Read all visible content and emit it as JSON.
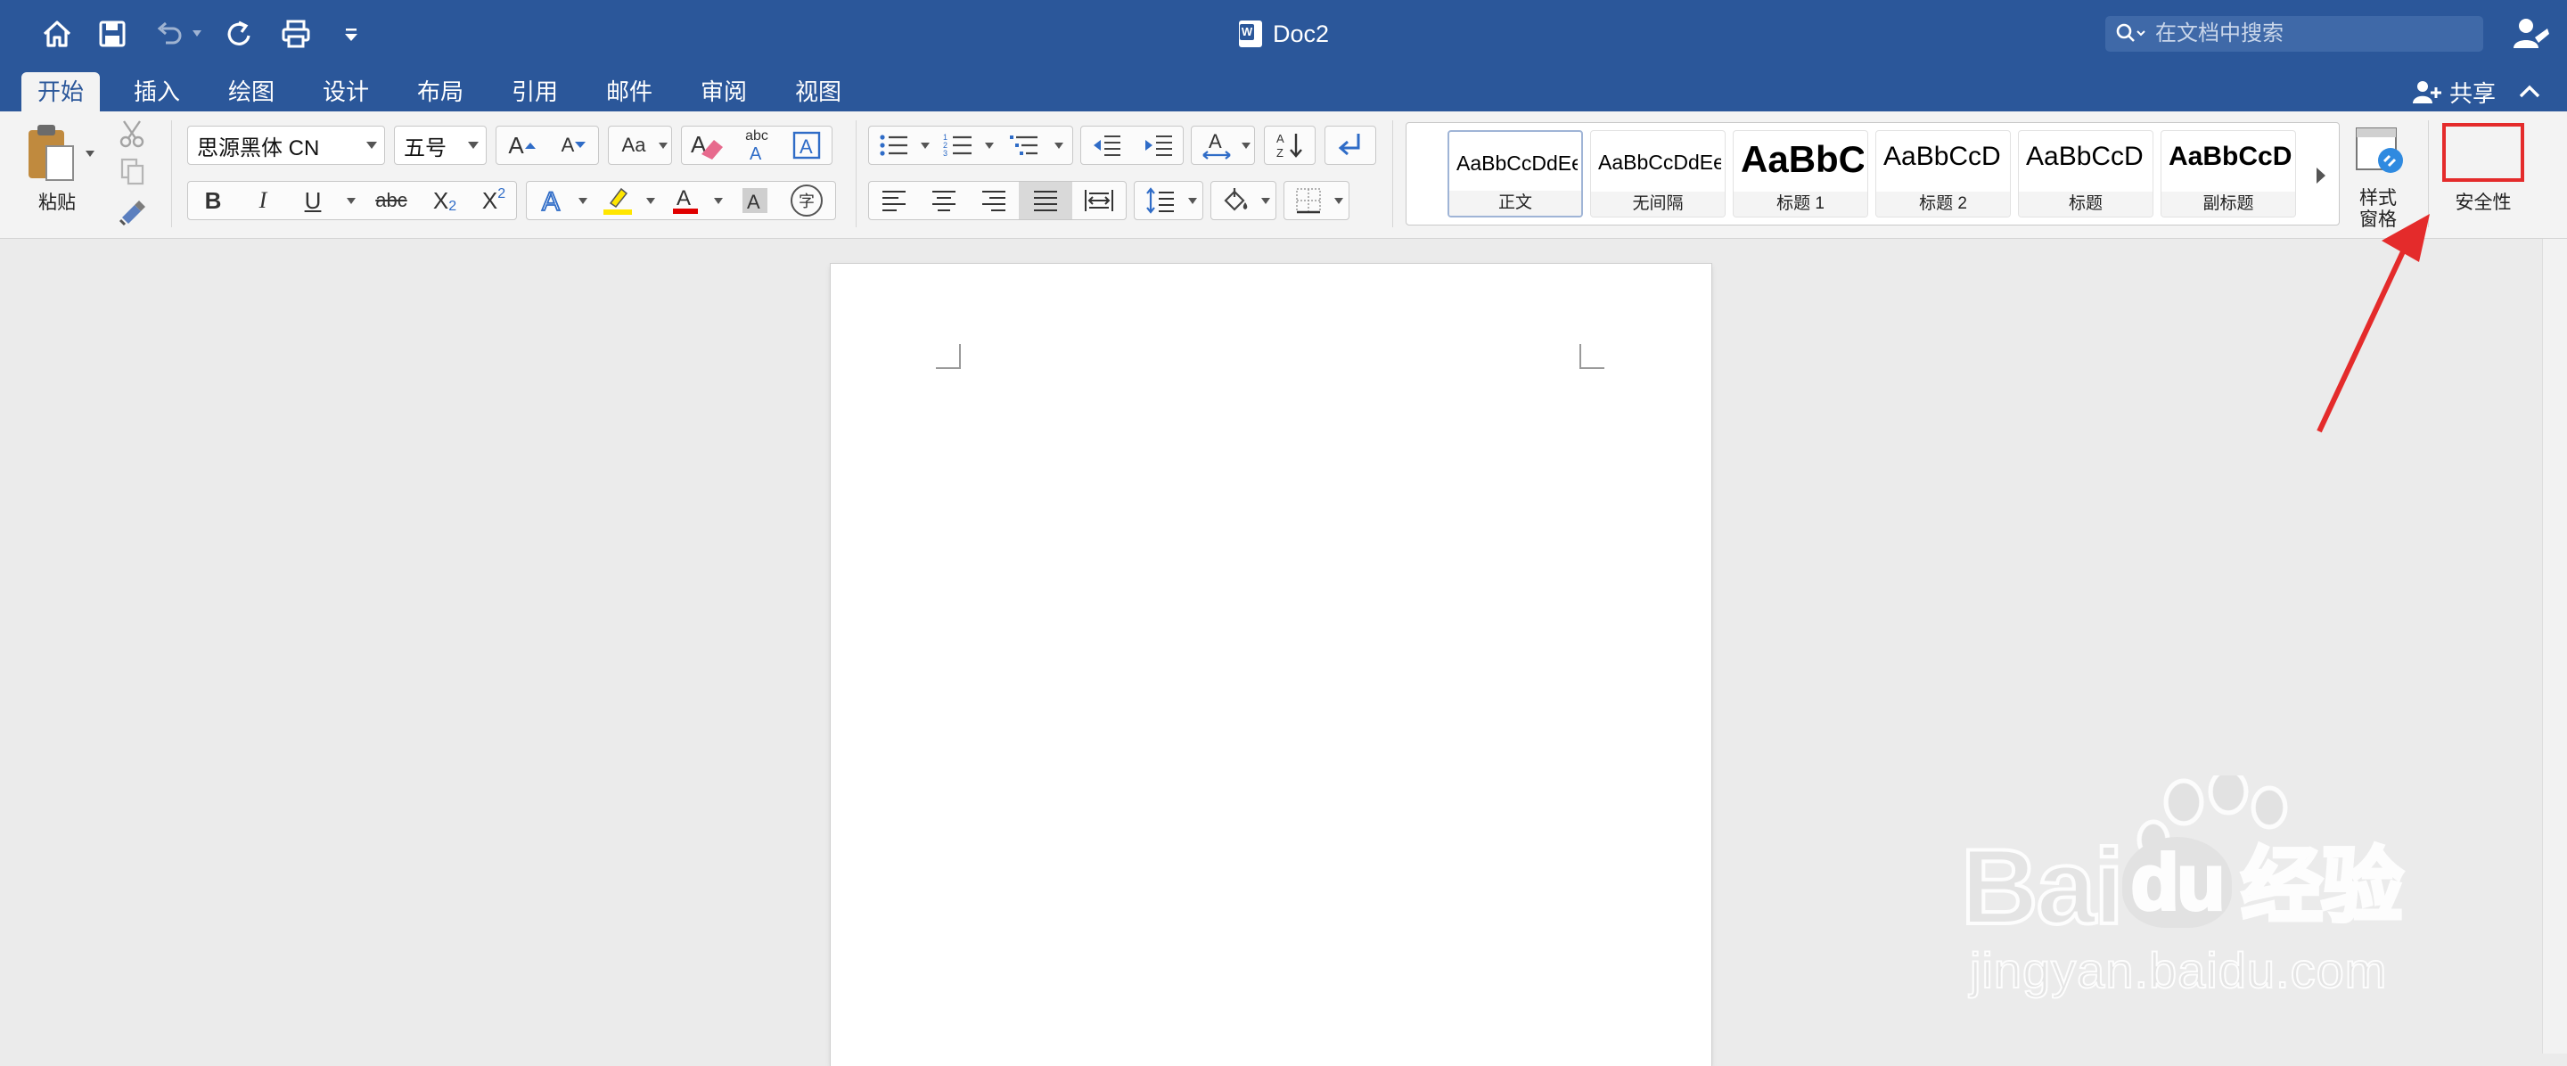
{
  "window": {
    "doc_title": "Doc2",
    "search_placeholder": "在文档中搜索"
  },
  "quick_access": {
    "icons": [
      "home-icon",
      "save-icon",
      "undo-icon",
      "redo-icon",
      "print-icon",
      "customize-icon"
    ]
  },
  "tabs": [
    {
      "label": "开始",
      "active": true
    },
    {
      "label": "插入"
    },
    {
      "label": "绘图"
    },
    {
      "label": "设计"
    },
    {
      "label": "布局"
    },
    {
      "label": "引用"
    },
    {
      "label": "邮件"
    },
    {
      "label": "审阅"
    },
    {
      "label": "视图"
    }
  ],
  "share_label": "共享",
  "ribbon": {
    "paste_label": "粘贴",
    "font_name": "思源黑体 CN",
    "font_size": "五号",
    "bold": "B",
    "italic": "I",
    "underline": "U",
    "strike": "abc",
    "subscript": "X",
    "subscript_small": "2",
    "superscript": "X",
    "superscript_small": "2",
    "grow_font": "A",
    "shrink_font": "A",
    "change_case": "Aa",
    "abc_label": "abc",
    "phonetic_label": "字",
    "styles": [
      {
        "sample": "AaBbCcDdEe",
        "name": "正文"
      },
      {
        "sample": "AaBbCcDdEe",
        "name": "无间隔"
      },
      {
        "sample": "AaBbC",
        "name": "标题 1"
      },
      {
        "sample": "AaBbCcD",
        "name": "标题 2"
      },
      {
        "sample": "AaBbCcD",
        "name": "标题"
      },
      {
        "sample": "AaBbCcD",
        "name": "副标题"
      }
    ],
    "styles_pane_label_1": "样式",
    "styles_pane_label_2": "窗格",
    "security_label": "安全性"
  },
  "watermark": {
    "brand": "Bai",
    "brand_du": "du",
    "cn": "经验",
    "url": "jingyan.baidu.com"
  },
  "colors": {
    "title_bar": "#2b579a",
    "ribbon": "#f3f3f3",
    "highlight_yellow": "#ffe600",
    "font_red": "#e00000",
    "annotation_red": "#e42b2b"
  }
}
